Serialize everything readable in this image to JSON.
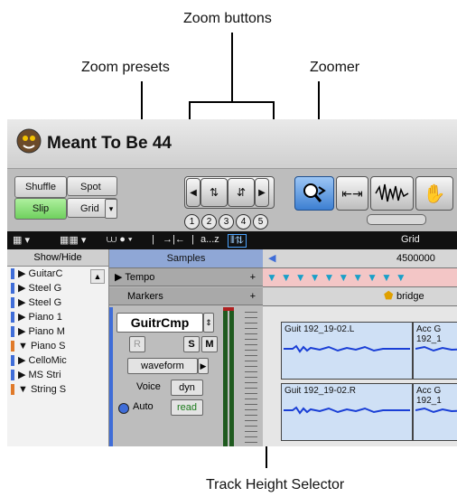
{
  "callouts": {
    "zoom_buttons": "Zoom buttons",
    "zoom_presets": "Zoom presets",
    "zoomer": "Zoomer",
    "track_height_selector": "Track Height Selector"
  },
  "window": {
    "title": "Meant To Be 44"
  },
  "modes": {
    "shuffle": "Shuffle",
    "spot": "Spot",
    "slip": "Slip",
    "grid": "Grid"
  },
  "zoom_presets": [
    "1",
    "2",
    "3",
    "4",
    "5"
  ],
  "toolbar2": {
    "az": "a...z",
    "grid": "Grid"
  },
  "left_panel": {
    "header": "Show/Hide",
    "items": [
      "GuitarC",
      "Steel G",
      "Steel G",
      "Piano 1",
      "Piano M",
      "Piano S",
      "CelloMic",
      "MS Stri",
      "String S"
    ]
  },
  "rulers": {
    "samples": "Samples",
    "tempo": "Tempo",
    "markers": "Markers",
    "counter": "4500000"
  },
  "track": {
    "name": "GuitrCmp",
    "r_label": "R",
    "s_label": "S",
    "m_label": "M",
    "view": "waveform",
    "voice_label": "Voice",
    "voice_value": "dyn",
    "auto_label": "Auto",
    "auto_value": "read"
  },
  "marker_name": "bridge",
  "clips": {
    "top_left": "Guit 192_19-02.L",
    "top_right": "Acc G 192_1",
    "bottom_left": "Guit 192_19-02.R",
    "bottom_right": "Acc G 192_1"
  },
  "colors": {
    "slip_active": "#8be07a",
    "zoomer_active": "#4a90e2",
    "marker_ruler": "#f3c6c6",
    "clip_bg": "#cfe0f5",
    "waveform": "#1a3fd6"
  }
}
